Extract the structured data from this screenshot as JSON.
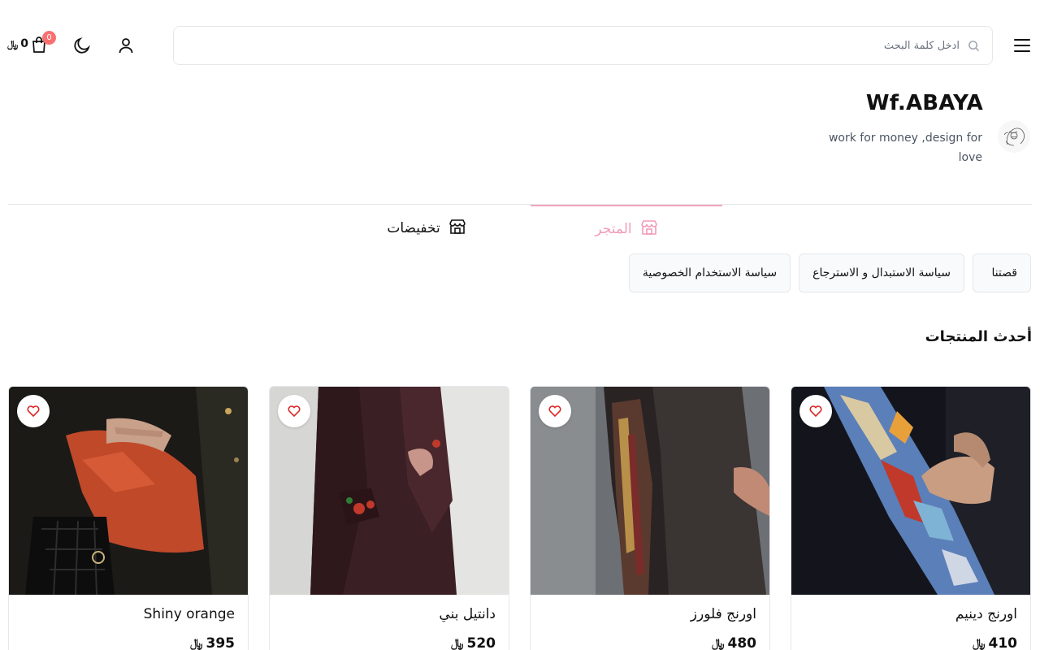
{
  "header": {
    "search_placeholder": "ادخل كلمة البحث",
    "cart_count": "0",
    "cart_total": "0",
    "currency_symbol": "﷼"
  },
  "store": {
    "name": "Wf.ABAYA",
    "description": "work for money ,design for love"
  },
  "tabs": [
    {
      "label": "المتجر",
      "icon": "store-icon",
      "active": true
    },
    {
      "label": "تخفيضات",
      "icon": "store-icon",
      "active": false
    }
  ],
  "pages": [
    {
      "label": "قصتنا"
    },
    {
      "label": "سياسة الاستبدال و الاسترجاع"
    },
    {
      "label": "سياسة الاستخدام الخصوصية"
    }
  ],
  "section": {
    "title": "أحدث المنتجات"
  },
  "products": [
    {
      "name": "اورنج دينيم",
      "price": "410",
      "currency": "﷼"
    },
    {
      "name": "اورنج فلورز",
      "price": "480",
      "currency": "﷼"
    },
    {
      "name": "دانتيل بني",
      "price": "520",
      "currency": "﷼"
    },
    {
      "name": "Shiny orange",
      "price": "395",
      "currency": "﷼"
    }
  ],
  "colors": {
    "accent_pink": "#f29bb8",
    "badge_red": "#f87171",
    "border": "#e5e7eb",
    "text": "#111111"
  }
}
